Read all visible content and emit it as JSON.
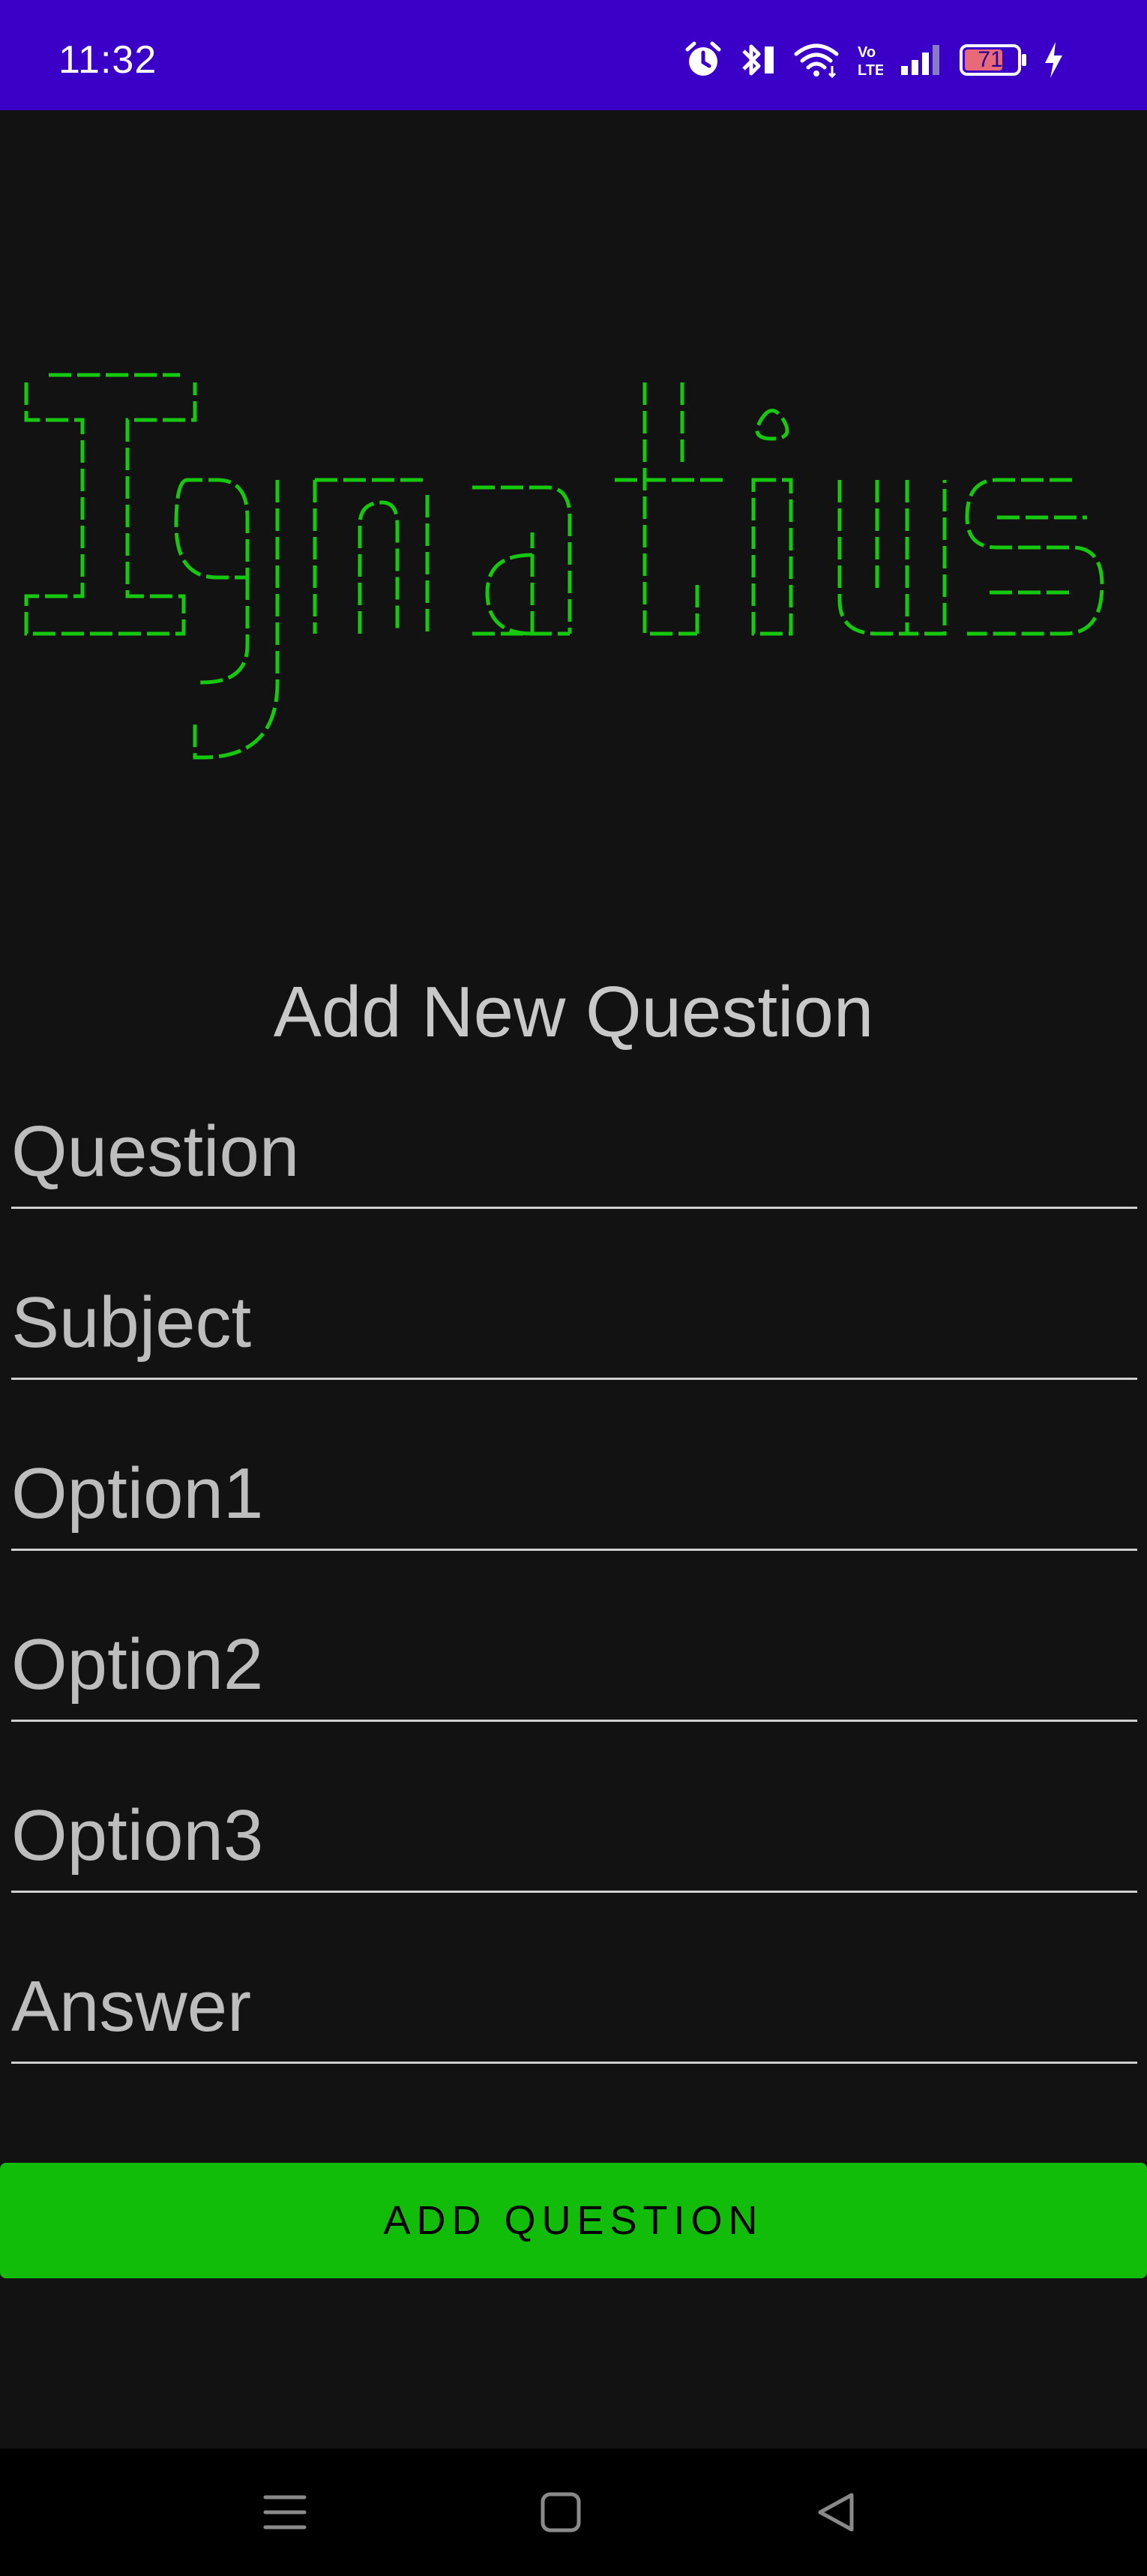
{
  "status_bar": {
    "time": "11:32",
    "battery_level": "71",
    "icons": [
      "alarm-icon",
      "bluetooth-icon",
      "wifi-icon",
      "volte-icon",
      "signal-icon",
      "battery-icon",
      "charging-icon"
    ]
  },
  "banner": {
    "logo_text": "Ignatius",
    "color": "#16c80e"
  },
  "form": {
    "title": "Add New Question",
    "fields": [
      {
        "placeholder": "Question",
        "value": ""
      },
      {
        "placeholder": "Subject",
        "value": ""
      },
      {
        "placeholder": "Option1",
        "value": ""
      },
      {
        "placeholder": "Option2",
        "value": ""
      },
      {
        "placeholder": "Option3",
        "value": ""
      },
      {
        "placeholder": "Answer",
        "value": ""
      }
    ],
    "submit_label": "ADD QUESTION"
  },
  "nav_bar": {
    "icons": [
      "menu-icon",
      "home-icon",
      "back-icon"
    ]
  },
  "colors": {
    "status_bar": "#3a00c8",
    "background": "#121212",
    "accent": "#12bd0a"
  }
}
